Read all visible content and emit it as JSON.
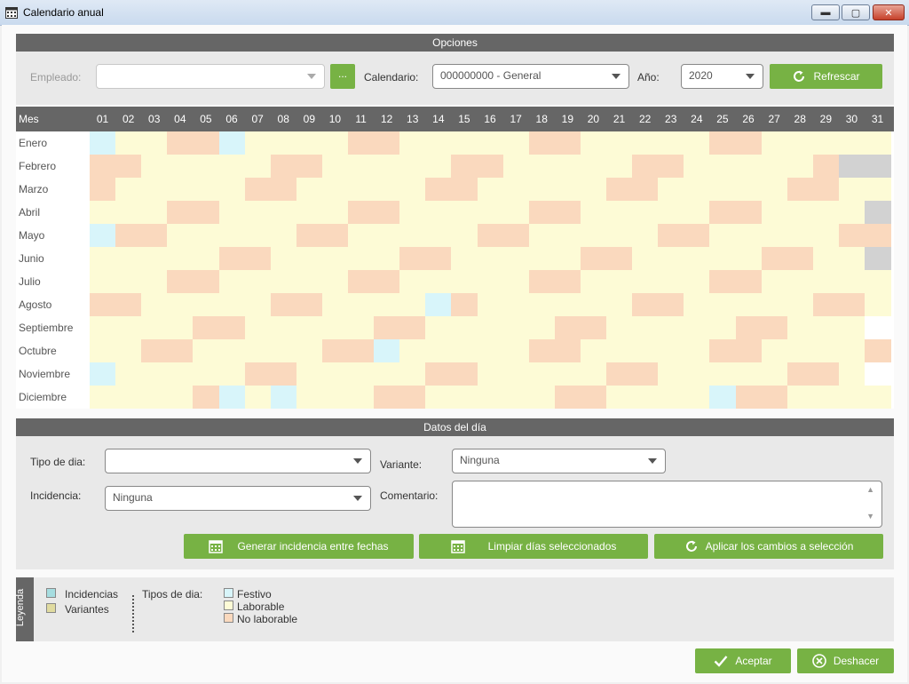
{
  "window": {
    "title": "Calendario anual"
  },
  "options": {
    "section_title": "Opciones",
    "employee_label": "Empleado:",
    "employee_value": "",
    "browse_label": "...",
    "calendar_label": "Calendario:",
    "calendar_value": "000000000 - General",
    "year_label": "Año:",
    "year_value": "2020",
    "refresh_label": "Refrescar"
  },
  "grid": {
    "month_header": "Mes",
    "days": [
      "01",
      "02",
      "03",
      "04",
      "05",
      "06",
      "07",
      "08",
      "09",
      "10",
      "11",
      "12",
      "13",
      "14",
      "15",
      "16",
      "17",
      "18",
      "19",
      "20",
      "21",
      "22",
      "23",
      "24",
      "25",
      "26",
      "27",
      "28",
      "29",
      "30",
      "31"
    ],
    "months": [
      {
        "name": "Enero",
        "days": "FLLNNFLLLLNNLLLLLNNLLLLLNNLLLLL"
      },
      {
        "name": "Febrero",
        "days": "NNLLLLLNNLLLLLNNLLLLLNNLLLLLNXX"
      },
      {
        "name": "Marzo",
        "days": "NLLLLLNNLLLLLNNLLLLLNNLLLLLNNLL"
      },
      {
        "name": "Abril",
        "days": "LLLNNLLLLLNNLLLLLNNLLLLLNNLLLLX"
      },
      {
        "name": "Mayo",
        "days": "FNNLLLLLNNLLLLLNNLLLLLNNLLLLLNN"
      },
      {
        "name": "Junio",
        "days": "LLLLLNNLLLLLNNLLLLLNNLLLLLNNLLX"
      },
      {
        "name": "Julio",
        "days": "LLLNNLLLLLNNLLLLLNNLLLLLNNLLLLL"
      },
      {
        "name": "Agosto",
        "days": "NNLLLLLNNLLLLFNLLLLLLNNLLLLLNNL"
      },
      {
        "name": "Septiembre",
        "days": "LLLLNNLLLLLNNLLLLLNNLLLLLNNLLLW"
      },
      {
        "name": "Octubre",
        "days": "LLNNLLLLLNNFLLLLLNNLLLLLNNLLLLN"
      },
      {
        "name": "Noviembre",
        "days": "FLLLLLNNLLLLLNNLLLLLNNLLLLLNNLW"
      },
      {
        "name": "Diciembre",
        "days": "LLLLNFLFLLLNNLLLLLNNLLLLFNNLLLL"
      }
    ]
  },
  "day_data": {
    "section_title": "Datos del día",
    "type_label": "Tipo de dia:",
    "type_value": "",
    "variant_label": "Variante:",
    "variant_value": "Ninguna",
    "incident_label": "Incidencia:",
    "incident_value": "Ninguna",
    "comment_label": "Comentario:",
    "comment_value": "",
    "generate_label": "Generar incidencia entre fechas",
    "clear_label": "Limpiar días seleccionados",
    "apply_label": "Aplicar los cambios a selección"
  },
  "legend": {
    "title": "Leyenda",
    "incidents": "Incidencias",
    "variants": "Variantes",
    "types_label": "Tipos de dia:",
    "holiday": "Festivo",
    "workday": "Laborable",
    "nonworkday": "No laborable"
  },
  "footer": {
    "accept_label": "Aceptar",
    "undo_label": "Deshacer"
  },
  "colors": {
    "L": "#fdfbd6",
    "N": "#fad9be",
    "F": "#d8f5fa",
    "X": "#d2d2d2",
    "W": "#ffffff",
    "green": "#77b244",
    "variant_swatch": "#e0dba0",
    "incident_swatch": "#a6dde0"
  }
}
